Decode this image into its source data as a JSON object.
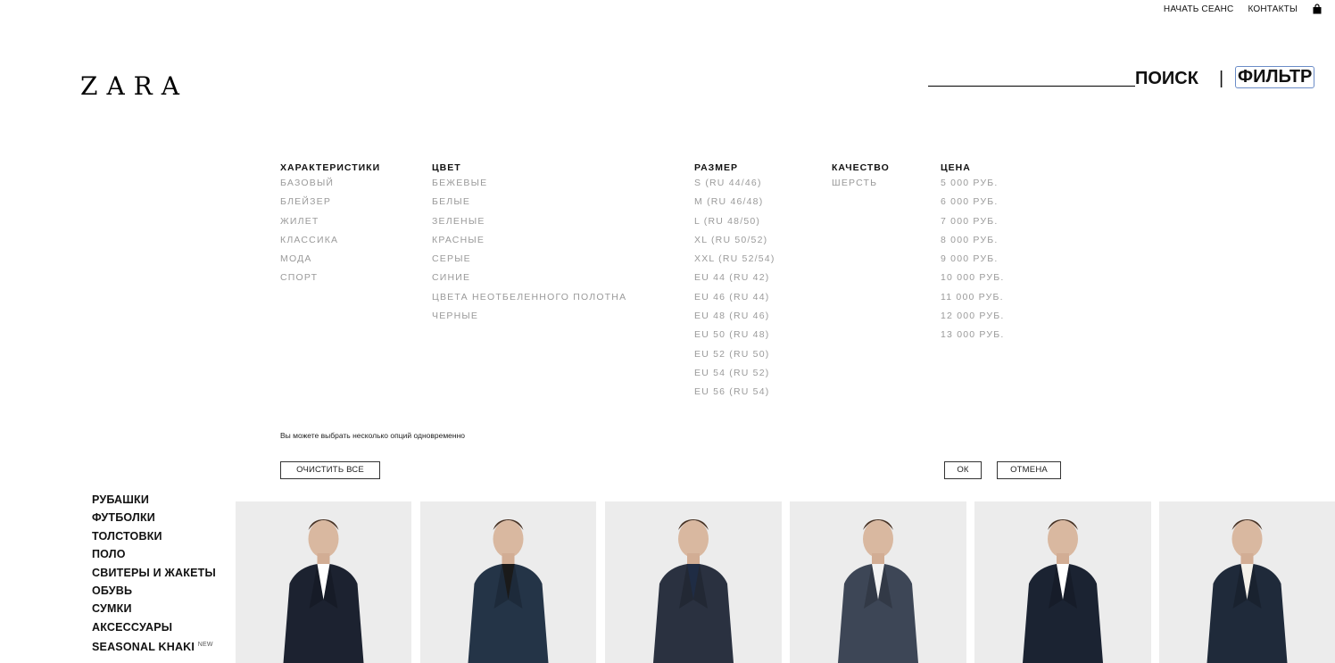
{
  "topbar": {
    "login": "НАЧАТЬ СЕАНС",
    "contacts": "КОНТАКТЫ"
  },
  "logo": "ZARA",
  "search": {
    "label": "ПОИСК",
    "separator": "|",
    "filter_label": "ФИЛЬТР"
  },
  "filters": {
    "characteristics": {
      "title": "ХАРАКТЕРИСТИКИ",
      "options": [
        "БАЗОВЫЙ",
        "БЛЕЙЗЕР",
        "ЖИЛЕТ",
        "КЛАССИКА",
        "МОДА",
        "СПОРТ"
      ]
    },
    "color": {
      "title": "ЦВЕТ",
      "options": [
        "БЕЖЕВЫЕ",
        "БЕЛЫЕ",
        "ЗЕЛЕНЫЕ",
        "КРАСНЫЕ",
        "СЕРЫЕ",
        "СИНИЕ",
        "ЦВЕТА НЕОТБЕЛЕННОГО ПОЛОТНА",
        "ЧЕРНЫЕ"
      ]
    },
    "size": {
      "title": "РАЗМЕР",
      "options": [
        "S (RU 44/46)",
        "M (RU 46/48)",
        "L (RU 48/50)",
        "XL (RU 50/52)",
        "XXL (RU 52/54)",
        "EU 44 (RU 42)",
        "EU 46 (RU 44)",
        "EU 48 (RU 46)",
        "EU 50 (RU 48)",
        "EU 52 (RU 50)",
        "EU 54 (RU 52)",
        "EU 56 (RU 54)"
      ]
    },
    "quality": {
      "title": "КАЧЕСТВО",
      "options": [
        "ШЕРСТЬ"
      ]
    },
    "price": {
      "title": "ЦЕНА",
      "options": [
        "5 000 РУБ.",
        "6 000 РУБ.",
        "7 000 РУБ.",
        "8 000 РУБ.",
        "9 000 РУБ.",
        "10 000 РУБ.",
        "11 000 РУБ.",
        "12 000 РУБ.",
        "13 000 РУБ."
      ]
    },
    "hint": "Вы можете выбрать несколько опций одновременно",
    "clear_all": "ОЧИСТИТЬ ВСЕ",
    "ok": "ОК",
    "cancel": "ОТМЕНА"
  },
  "categories": [
    {
      "label": "РУБАШКИ"
    },
    {
      "label": "ФУТБОЛКИ"
    },
    {
      "label": "ТОЛСТОВКИ"
    },
    {
      "label": "ПОЛО"
    },
    {
      "label": "СВИТЕРЫ И ЖАКЕТЫ"
    },
    {
      "label": "ОБУВЬ"
    },
    {
      "label": "СУМКИ"
    },
    {
      "label": "АКСЕССУАРЫ"
    },
    {
      "label": "SEASONAL KHAKI",
      "badge": "NEW"
    }
  ],
  "products": [
    {
      "jacket": "#1c2230",
      "inner": "#ffffff"
    },
    {
      "jacket": "#243447",
      "inner": "#1a1a1a"
    },
    {
      "jacket": "#2a3140",
      "inner": "#1f2c44"
    },
    {
      "jacket": "#3d4656",
      "inner": "#f2f2f2"
    },
    {
      "jacket": "#1b2332",
      "inner": "#ffffff"
    },
    {
      "jacket": "#1f2a3a",
      "inner": "#f4f1ea"
    }
  ],
  "colors": {
    "option_text": "#9a9a9a",
    "tile_bg": "#ececec",
    "filter_outline": "#6b8cc7"
  }
}
